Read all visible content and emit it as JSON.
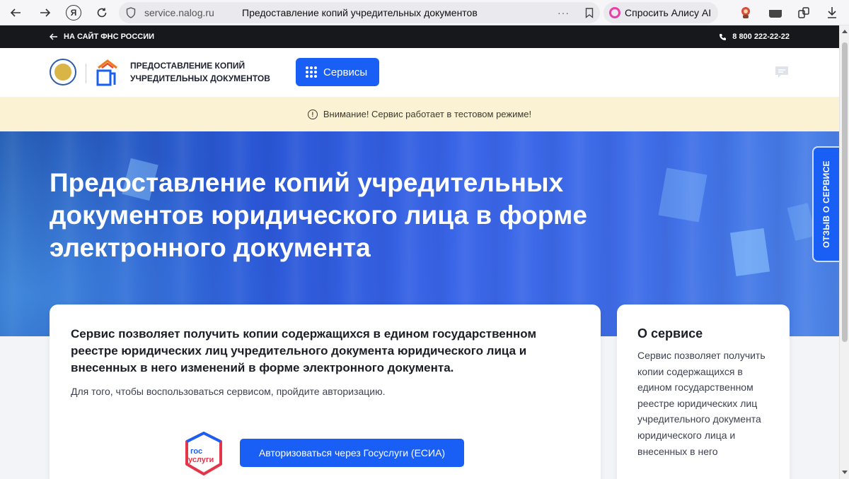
{
  "browser": {
    "url_domain": "service.nalog.ru",
    "tab_title": "Предоставление копий учредительных документов",
    "more": "···",
    "alice_label": "Спросить Алису AI",
    "yandex_letter": "Я"
  },
  "topbar": {
    "back_link": "НА САЙТ ФНС РОССИИ",
    "phone": "8 800 222-22-22"
  },
  "header": {
    "service_title": "ПРЕДОСТАВЛЕНИЕ КОПИЙ УЧРЕДИТЕЛЬНЫХ ДОКУМЕНТОВ",
    "services_button": "Сервисы"
  },
  "warning": {
    "text": "Внимание! Сервис работает в тестовом режиме!"
  },
  "hero": {
    "title": "Предоставление копий учредительных документов юридического лица в форме электронного документа"
  },
  "feedback": {
    "label": "ОТЗЫВ О СЕРВИСЕ"
  },
  "main_card": {
    "heading": "Сервис позволяет получить копии содержащихся в едином государственном реестре юридических лиц учредительного документа юридического лица и внесенных в него изменений в форме электронного документа.",
    "subtext": "Для того, чтобы воспользоваться сервисом, пройдите авторизацию.",
    "gos_logo_text": "гос услуги",
    "esia_button": "Авторизоваться через Госуслуги (ЕСИА)"
  },
  "side_card": {
    "title": "О сервисе",
    "text": "Сервис позволяет получить копии содержащихся в едином государственном реестре юридических лиц учредительного документа юридического лица и внесенных в него"
  },
  "colors": {
    "accent": "#1a5ff5",
    "warning_bg": "#fbf1d3",
    "topbar_bg": "#17181c"
  }
}
